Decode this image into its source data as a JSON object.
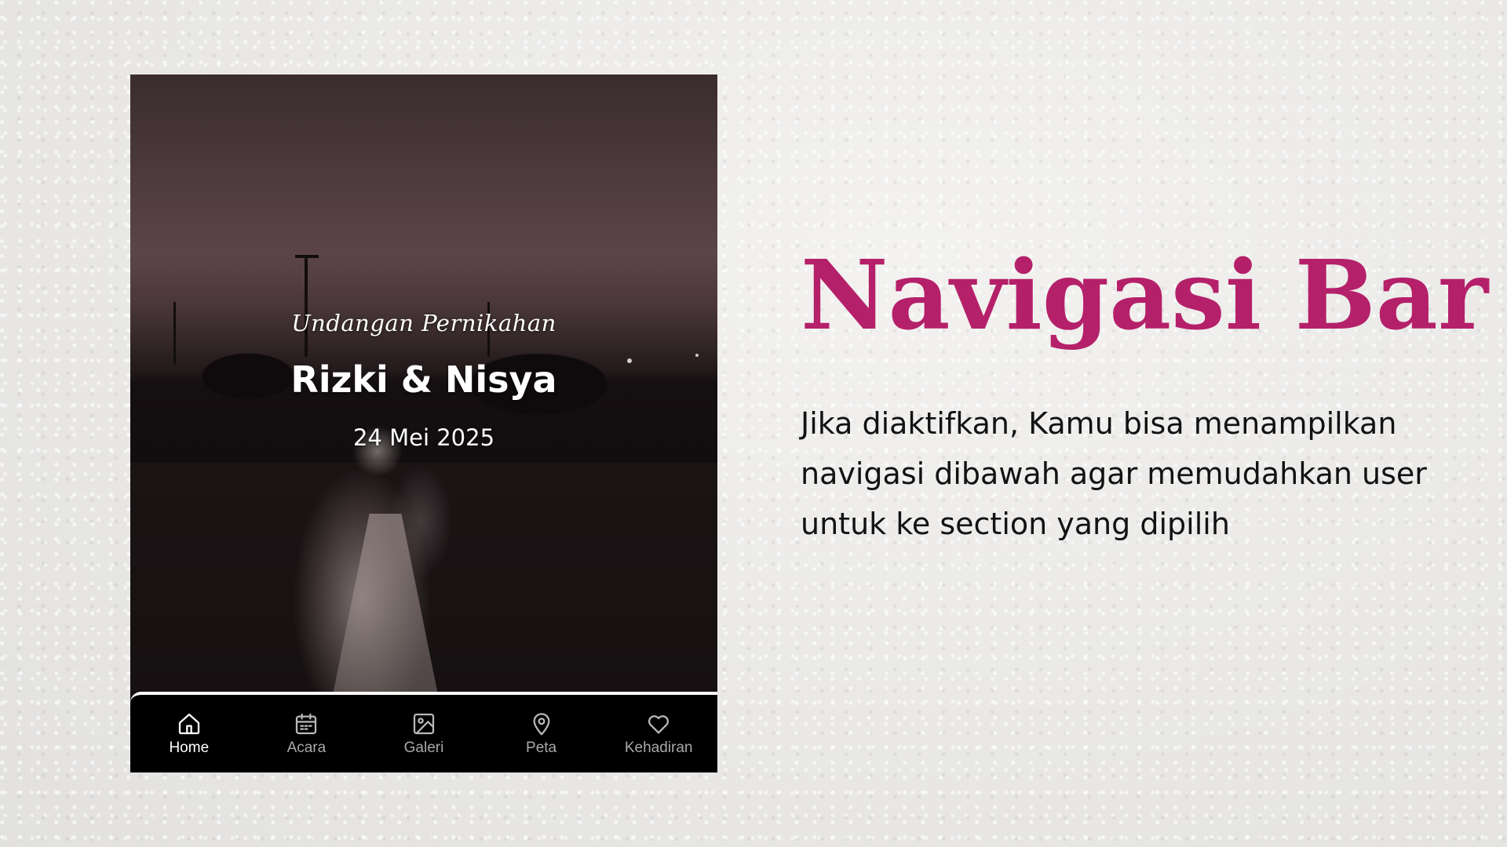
{
  "invitation": {
    "script_title": "Undangan Pernikahan",
    "couple_names": "Rizki & Nisya",
    "date": "24 Mei 2025"
  },
  "bottom_nav": {
    "active": "Home",
    "items": [
      {
        "label": "Home",
        "icon": "home-icon"
      },
      {
        "label": "Acara",
        "icon": "calendar-icon"
      },
      {
        "label": "Galeri",
        "icon": "image-icon"
      },
      {
        "label": "Peta",
        "icon": "map-pin-icon"
      },
      {
        "label": "Kehadiran",
        "icon": "heart-icon"
      }
    ]
  },
  "feature": {
    "title": "Navigasi Bar",
    "description": "Jika diaktifkan, Kamu bisa menampilkan navigasi dibawah agar memudahkan user untuk ke section yang dipilih"
  },
  "colors": {
    "accent": "#b5206a",
    "nav_background": "#000000",
    "text": "#121212"
  }
}
